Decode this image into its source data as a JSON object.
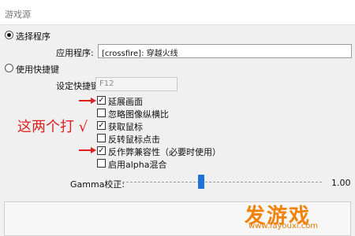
{
  "window": {
    "title": "游戏源"
  },
  "source_mode": {
    "select_program": {
      "label": "选择程序",
      "selected": true
    },
    "use_hotkey": {
      "label": "使用快捷键",
      "selected": false
    }
  },
  "application": {
    "label": "应用程序:",
    "value": "[crossfire]: 穿越火线"
  },
  "hotkey": {
    "label": "设定快捷键",
    "value": "F12"
  },
  "options": [
    {
      "label": "延展画面",
      "checked": true
    },
    {
      "label": "忽略图像纵横比",
      "checked": false
    },
    {
      "label": "获取鼠标",
      "checked": true
    },
    {
      "label": "反转鼠标点击",
      "checked": false
    },
    {
      "label": "反作弊兼容性（必要时使用）",
      "checked": true
    },
    {
      "label": "启用alpha混合",
      "checked": false
    }
  ],
  "annotation": {
    "text": "这两个打 √",
    "color": "#e02020"
  },
  "gamma": {
    "label": "Gamma校正:",
    "value_text": "1.00",
    "position_fraction": 0.4
  },
  "watermark": {
    "main": "发游戏",
    "url": "www.fayouxi.com",
    "color": "#f2820a"
  },
  "colors": {
    "accent": "#1e73d8",
    "annotation_red": "#e02020"
  }
}
